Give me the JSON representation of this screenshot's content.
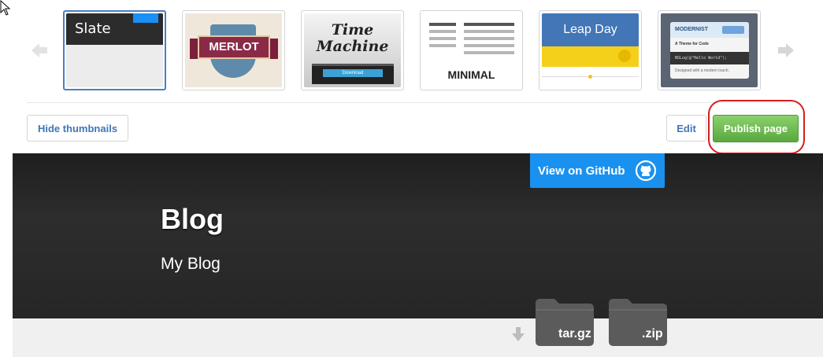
{
  "themes": [
    {
      "name": "Slate",
      "label": "Slate",
      "selected": true
    },
    {
      "name": "Merlot",
      "label": "MERLOT"
    },
    {
      "name": "Time Machine",
      "line1": "Time",
      "line2": "Machine",
      "button": "Download"
    },
    {
      "name": "Minimal",
      "label": "MINIMAL"
    },
    {
      "name": "Leap Day",
      "label": "Leap Day"
    },
    {
      "name": "Modernist",
      "header": "MODERNIST",
      "subtitle": "A Theme for Code",
      "code": "NSLog(@\"Hello World\");",
      "footer": "Designed with a modern touch."
    }
  ],
  "actions": {
    "hide_thumbnails": "Hide thumbnails",
    "edit": "Edit",
    "publish": "Publish page"
  },
  "preview": {
    "github_button": "View on GitHub",
    "title": "Blog",
    "subtitle": "My Blog",
    "downloads": [
      ".tar.gz",
      ".zip"
    ],
    "download_labels": [
      "tar.gz",
      ".zip"
    ]
  },
  "colors": {
    "selected_border": "#4a7fc0",
    "publish_green": "#5ba83f",
    "github_blue": "#1a91ef",
    "highlight_red": "#d61d1d",
    "header_dark": "#262626"
  },
  "icons": {
    "cursor": "cursor-arrow-icon",
    "prev": "arrow-left-icon",
    "next": "arrow-right-icon",
    "github": "github-octocat-icon",
    "download": "arrow-down-icon",
    "folder": "folder-icon"
  }
}
